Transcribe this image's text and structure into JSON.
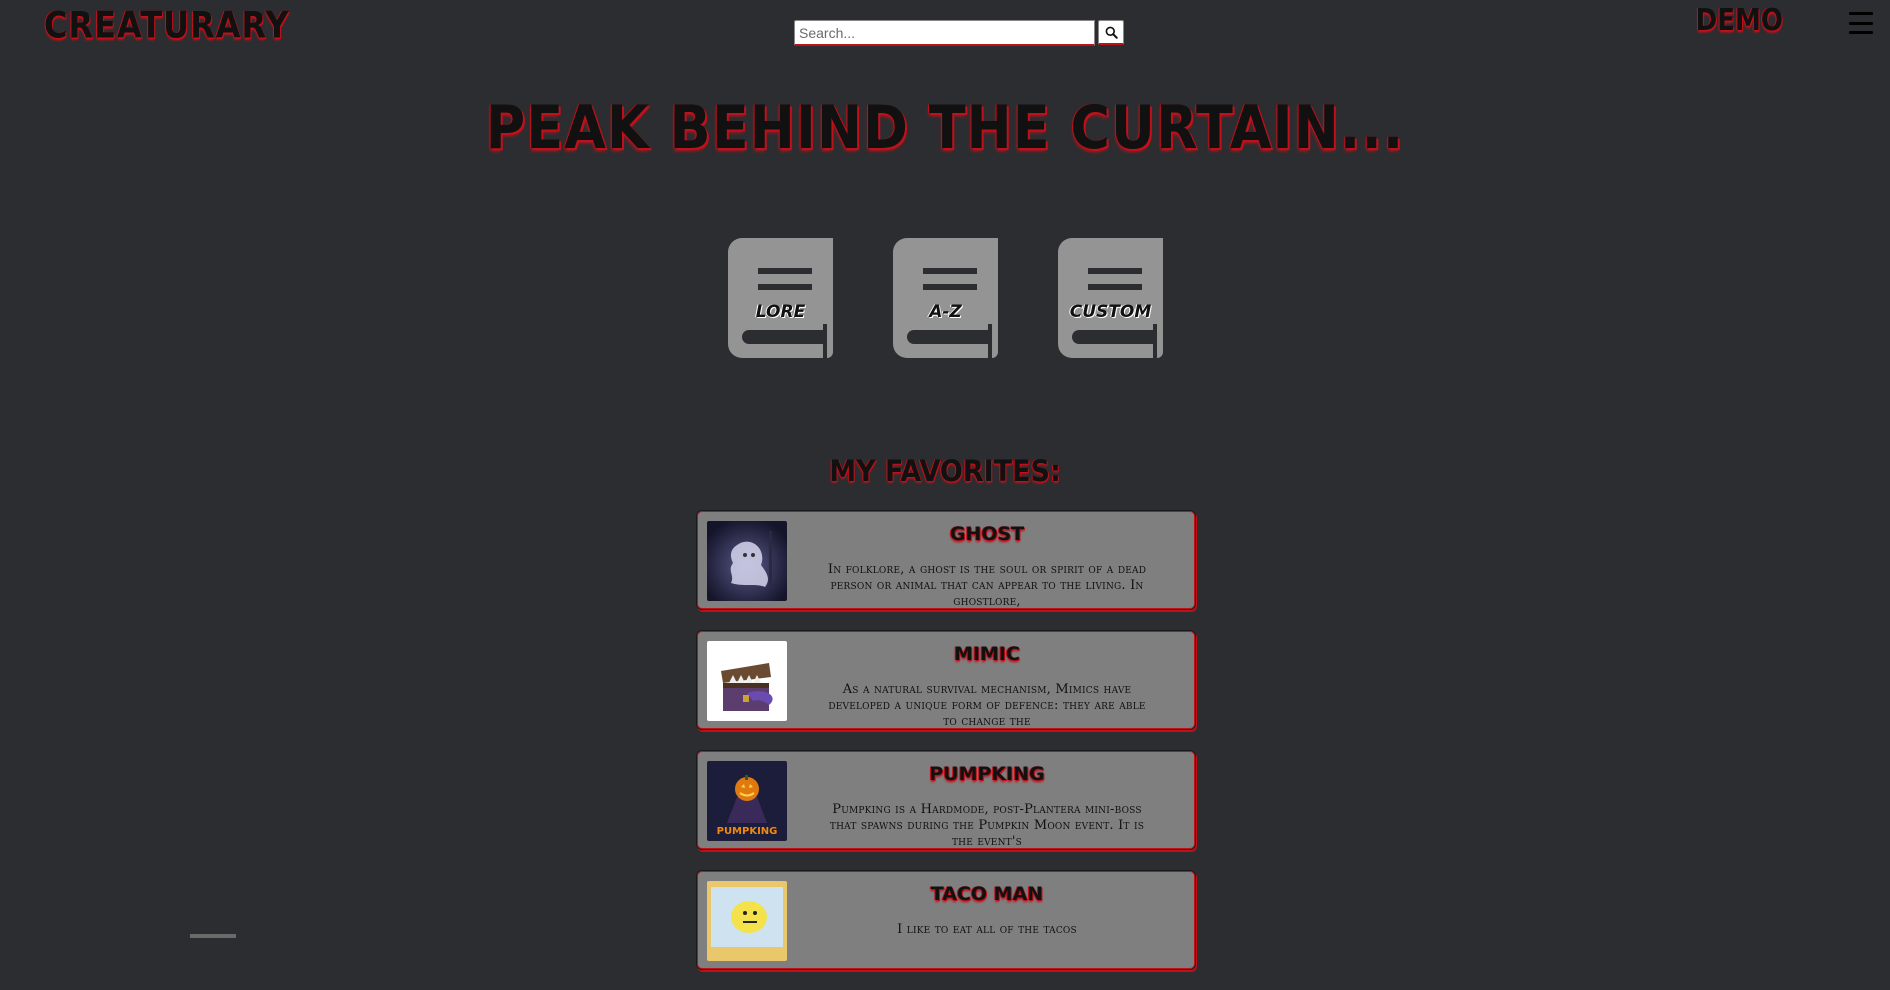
{
  "header": {
    "logo": "CREATURARY",
    "search_placeholder": "Search...",
    "search_value": "",
    "search_icon": "search-icon",
    "user": "DEMO",
    "menu_icon": "hamburger-menu-icon"
  },
  "hero": {
    "title": "PEAK BEHIND THE CURTAIN..."
  },
  "categories": [
    {
      "label": "Lore",
      "icon": "book-icon"
    },
    {
      "label": "A-Z",
      "icon": "book-icon"
    },
    {
      "label": "Custom",
      "icon": "book-icon"
    }
  ],
  "favorites": {
    "heading": "MY FAVORITES:",
    "items": [
      {
        "name": "Ghost",
        "desc": "In folklore, a ghost is the soul or spirit of a dead person or animal that can appear to the living. In ghostlore,"
      },
      {
        "name": "Mimic",
        "desc": "As a natural survival mechanism, Mimics have developed a unique form of defence: they are able to change the"
      },
      {
        "name": "Pumpking",
        "desc": "Pumpking is a Hardmode, post-Plantera mini-boss that spawns during the Pumpkin Moon event. It is the event's",
        "thumb_text": "PUMPKING"
      },
      {
        "name": "Taco Man",
        "desc": "I like to eat all of the tacos"
      }
    ]
  },
  "colors": {
    "background": "#2c2d30",
    "accent": "#c0101a",
    "card": "#7f7f7f",
    "book": "#949494"
  }
}
